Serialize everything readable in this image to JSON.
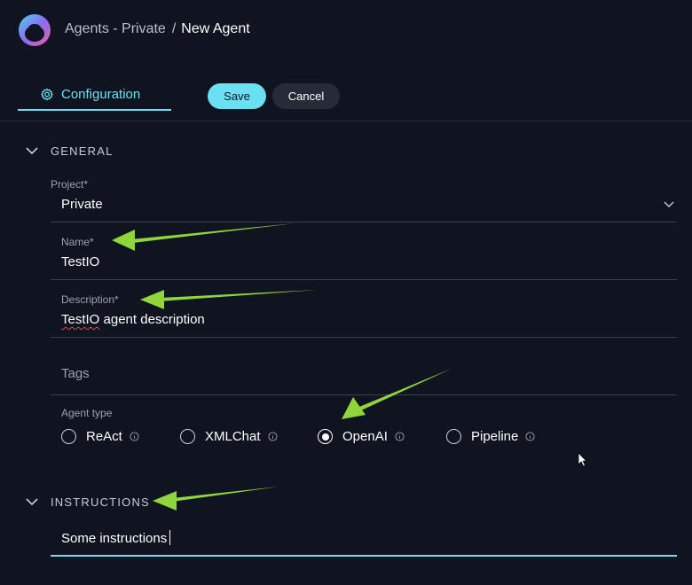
{
  "header": {
    "breadcrumb_parent": "Agents - Private",
    "breadcrumb_separator": "/",
    "breadcrumb_current": "New Agent"
  },
  "toolbar": {
    "tab_label": "Configuration",
    "save_label": "Save",
    "cancel_label": "Cancel"
  },
  "general": {
    "title": "GENERAL",
    "project": {
      "label": "Project*",
      "value": "Private"
    },
    "name": {
      "label": "Name*",
      "value": "TestIO"
    },
    "description": {
      "label": "Description*",
      "value_word": "TestIO",
      "value_rest": " agent description"
    },
    "tags": {
      "placeholder": "Tags"
    },
    "agent_type": {
      "label": "Agent type",
      "options": [
        "ReAct",
        "XMLChat",
        "OpenAI",
        "Pipeline"
      ],
      "selected": "OpenAI"
    }
  },
  "instructions": {
    "title": "INSTRUCTIONS",
    "value": "Some instructions"
  },
  "colors": {
    "accent": "#6ae0f2",
    "background": "#0f1420",
    "annotation_arrow": "#8fd63a"
  }
}
